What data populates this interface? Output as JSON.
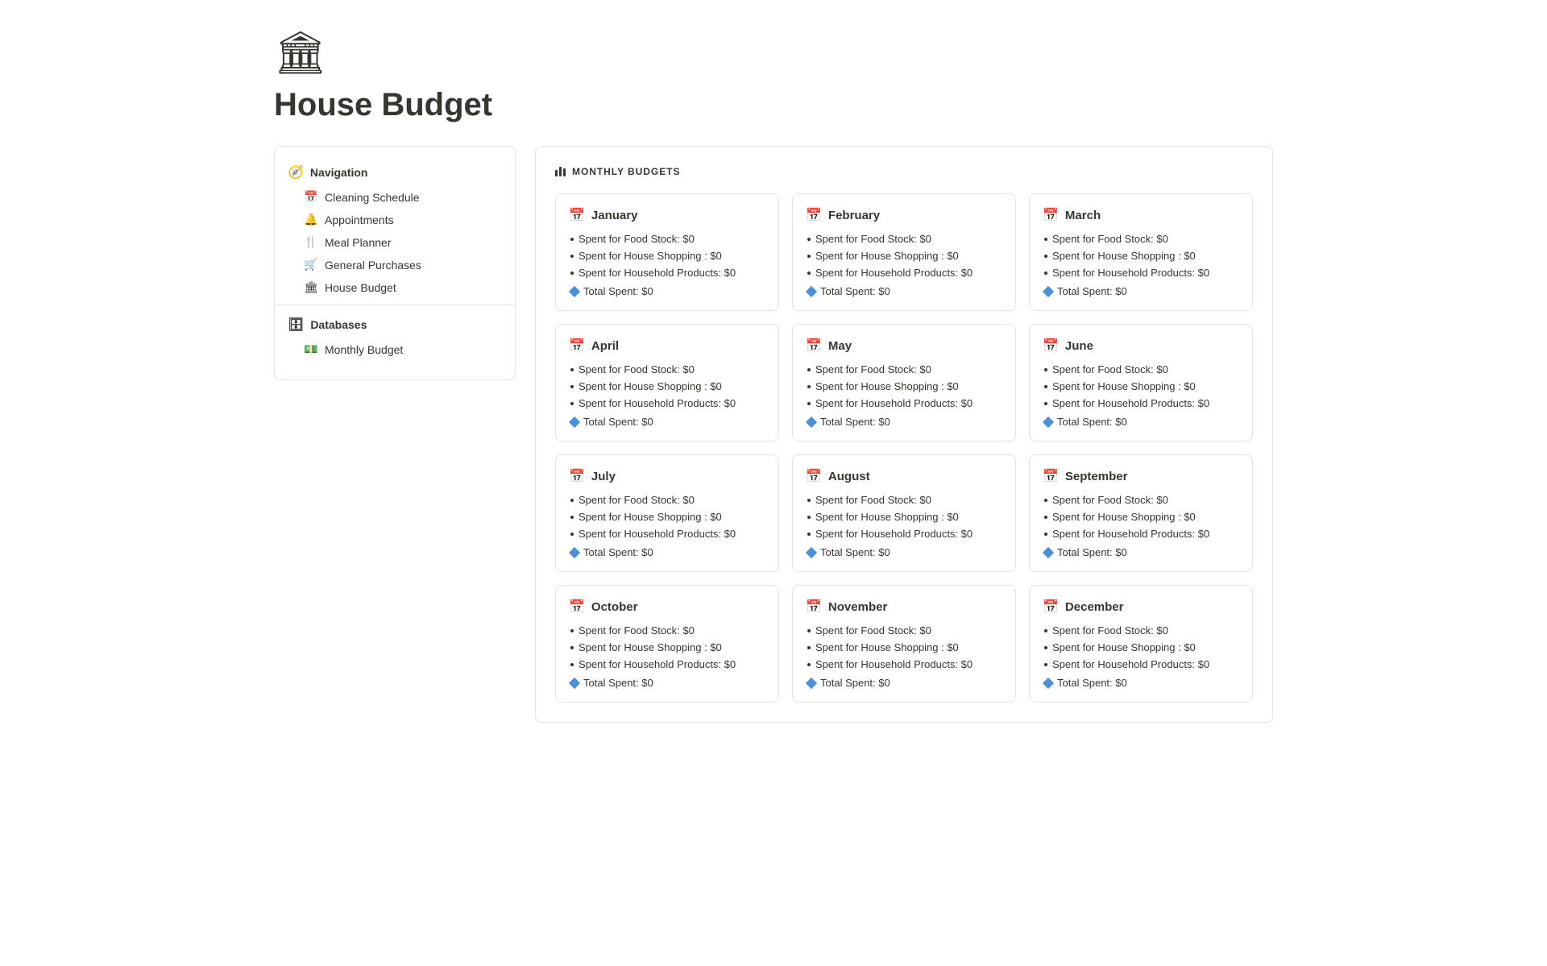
{
  "page": {
    "icon": "🏛",
    "title": "House Budget"
  },
  "sidebar": {
    "navigation_label": "Navigation",
    "navigation_icon": "🧭",
    "nav_items": [
      {
        "id": "cleaning-schedule",
        "label": "Cleaning Schedule",
        "icon": "📅"
      },
      {
        "id": "appointments",
        "label": "Appointments",
        "icon": "🔔"
      },
      {
        "id": "meal-planner",
        "label": "Meal Planner",
        "icon": "🍴"
      },
      {
        "id": "general-purchases",
        "label": "General Purchases",
        "icon": "🛒"
      },
      {
        "id": "house-budget",
        "label": "House Budget",
        "icon": "🏛"
      }
    ],
    "databases_label": "Databases",
    "databases_icon": "🗄",
    "db_items": [
      {
        "id": "monthly-budget",
        "label": "Monthly Budget",
        "icon": "💵"
      }
    ]
  },
  "main": {
    "section_title": "MONTHLY BUDGETS",
    "months": [
      {
        "name": "January",
        "food_stock": "$0",
        "house_shopping": "$0",
        "household_products": "$0",
        "total": "$0"
      },
      {
        "name": "February",
        "food_stock": "$0",
        "house_shopping": "$0",
        "household_products": "$0",
        "total": "$0"
      },
      {
        "name": "March",
        "food_stock": "$0",
        "house_shopping": "$0",
        "household_products": "$0",
        "total": "$0"
      },
      {
        "name": "April",
        "food_stock": "$0",
        "house_shopping": "$0",
        "household_products": "$0",
        "total": "$0"
      },
      {
        "name": "May",
        "food_stock": "$0",
        "house_shopping": "$0",
        "household_products": "$0",
        "total": "$0"
      },
      {
        "name": "June",
        "food_stock": "$0",
        "house_shopping": "$0",
        "household_products": "$0",
        "total": "$0"
      },
      {
        "name": "July",
        "food_stock": "$0",
        "house_shopping": "$0",
        "household_products": "$0",
        "total": "$0"
      },
      {
        "name": "August",
        "food_stock": "$0",
        "house_shopping": "$0",
        "household_products": "$0",
        "total": "$0"
      },
      {
        "name": "September",
        "food_stock": "$0",
        "house_shopping": "$0",
        "household_products": "$0",
        "total": "$0"
      },
      {
        "name": "October",
        "food_stock": "$0",
        "house_shopping": "$0",
        "household_products": "$0",
        "total": "$0"
      },
      {
        "name": "November",
        "food_stock": "$0",
        "house_shopping": "$0",
        "household_products": "$0",
        "total": "$0"
      },
      {
        "name": "December",
        "food_stock": "$0",
        "house_shopping": "$0",
        "household_products": "$0",
        "total": "$0"
      }
    ],
    "line_labels": {
      "food_stock": "Spent for Food Stock:",
      "house_shopping": "Spent for House Shopping :",
      "household_products": "Spent for Household Products:",
      "total": "Total Spent:"
    }
  }
}
